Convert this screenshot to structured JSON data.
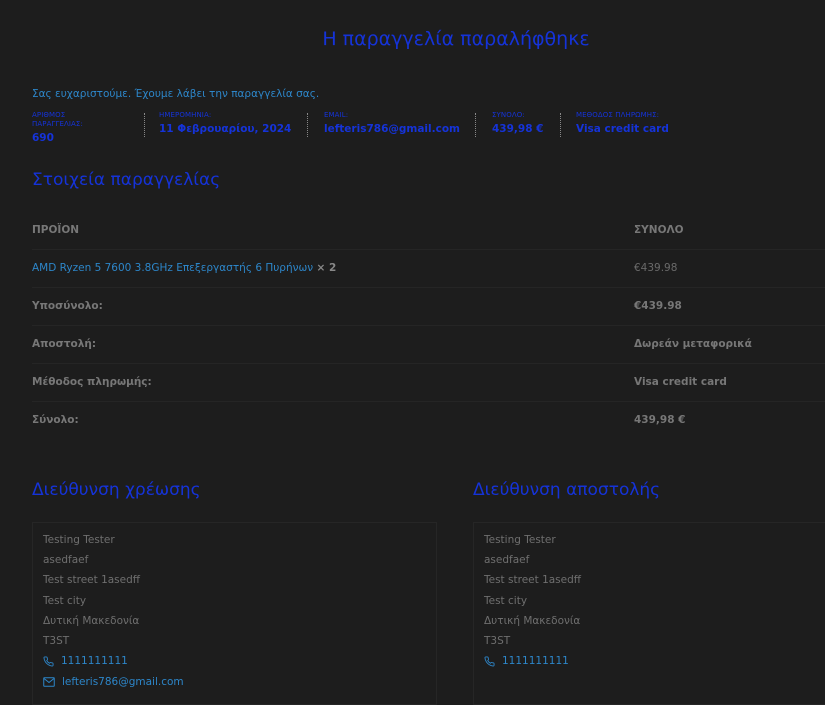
{
  "page_title": "Η παραγγελία παραλήφθηκε",
  "thank_you_text": "Σας ευχαριστούμε. Έχουμε λάβει την παραγγελία σας.",
  "overview": [
    {
      "label": "ΑΡΙΘΜΟΣ ΠΑΡΑΓΓΕΛΙΑΣ:",
      "value": "690"
    },
    {
      "label": "ΗΜΕΡΟΜΗΝΙΑ:",
      "value": "11 Φεβρουαρίου, 2024"
    },
    {
      "label": "EMAIL:",
      "value": "lefteris786@gmail.com"
    },
    {
      "label": "ΣΥΝΟΛΟ:",
      "value": "439,98 €"
    },
    {
      "label": "ΜΕΘΟΔΟΣ ΠΛΗΡΩΜΗΣ:",
      "value": "Visa credit card"
    }
  ],
  "order_details": {
    "title": "Στοιχεία παραγγελίας",
    "header": {
      "product": "ΠΡΟΪΟΝ",
      "total": "ΣΥΝΟΛΟ"
    },
    "item": {
      "name": "AMD Ryzen 5 7600 3.8GHz Επεξεργαστής 6 Πυρήνων",
      "quantity": "× 2",
      "total": "€439.98"
    },
    "subtotal": {
      "label": "Υποσύνολο:",
      "value": "€439.98"
    },
    "shipping": {
      "label": "Αποστολή:",
      "value": "Δωρεάν μεταφορικά"
    },
    "payment_method": {
      "label": "Μέθοδος πληρωμής:",
      "value": "Visa credit card"
    },
    "total": {
      "label": "Σύνολο:",
      "value": "439,98 €"
    }
  },
  "billing_address": {
    "title": "Διεύθυνση χρέωσης",
    "name": "Testing Tester",
    "company": "asedfaef",
    "street": "Test street 1asedff",
    "city": "Test city",
    "region": "Δυτική Μακεδονία",
    "postcode": "T3ST",
    "phone": "1111111111",
    "email": "lefteris786@gmail.com"
  },
  "shipping_address": {
    "title": "Διεύθυνση αποστολής",
    "name": "Testing Tester",
    "company": "asedfaef",
    "street": "Test street 1asedff",
    "city": "Test city",
    "region": "Δυτική Μακεδονία",
    "postcode": "T3ST",
    "phone": "1111111111"
  },
  "colors": {
    "background": "#1d1d1d",
    "accent_blue": "#1533d9",
    "link_blue": "#2d86c9",
    "text_gray": "#777777"
  },
  "icons": {
    "phone": "phone-icon",
    "email": "envelope-icon"
  }
}
